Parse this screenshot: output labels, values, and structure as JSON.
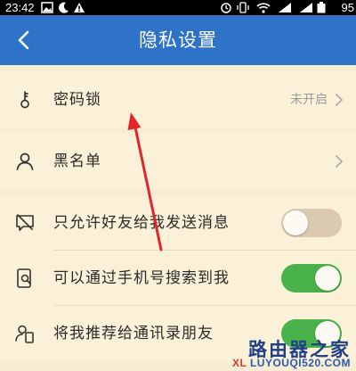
{
  "status_bar": {
    "time": "23:42",
    "battery": "95"
  },
  "header": {
    "title": "隐私设置"
  },
  "rows": {
    "password_lock": {
      "label": "密码锁",
      "value": "未开启"
    },
    "blacklist": {
      "label": "黑名单"
    },
    "friends_only": {
      "label": "只允许好友给我发送消息",
      "enabled": false
    },
    "phone_search": {
      "label": "可以通过手机号搜索到我",
      "enabled": true
    },
    "recommend_contacts": {
      "label": "将我推荐给通讯录朋友",
      "enabled": true
    }
  },
  "watermark": {
    "main": "路由器之家",
    "url_prefix": "XL ",
    "url": "LUYOUQI520.COM"
  },
  "colors": {
    "header": "#2e73c8",
    "background": "#f7edd4",
    "toggle_on": "#4ab24a",
    "toggle_off": "#dcc9b2",
    "arrow": "#e0262a"
  }
}
